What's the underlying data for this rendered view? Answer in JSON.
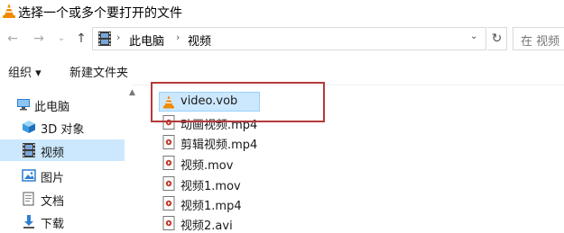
{
  "window": {
    "title": "选择一个或多个要打开的文件"
  },
  "navigation": {
    "back_icon": "←",
    "forward_icon": "→",
    "dropdown_icon": "⌄",
    "up_icon": "↑"
  },
  "address_bar": {
    "breadcrumbs": [
      "此电脑",
      "视频"
    ],
    "separator": "›",
    "dropdown_icon": "⌄",
    "refresh_icon": "↻"
  },
  "search": {
    "placeholder": "在 视频"
  },
  "toolbar": {
    "organize_label": "组织 ▾",
    "new_folder_label": "新建文件夹"
  },
  "sidebar": {
    "items": [
      {
        "label": "此电脑",
        "icon": "computer-icon",
        "selected": false
      },
      {
        "label": "3D 对象",
        "icon": "cube-icon",
        "selected": false
      },
      {
        "label": "视频",
        "icon": "film-icon",
        "selected": true
      },
      {
        "label": "图片",
        "icon": "picture-icon",
        "selected": false
      },
      {
        "label": "文档",
        "icon": "document-icon",
        "selected": false
      },
      {
        "label": "下载",
        "icon": "download-icon",
        "selected": false
      }
    ]
  },
  "files": [
    {
      "name": "video.vob",
      "icon": "vlc-cone-icon",
      "selected": true
    },
    {
      "name": "动画视频.mp4",
      "icon": "video-file-icon",
      "selected": false
    },
    {
      "name": "剪辑视频.mp4",
      "icon": "video-file-icon",
      "selected": false
    },
    {
      "name": "视频.mov",
      "icon": "video-file-icon",
      "selected": false
    },
    {
      "name": "视频1.mov",
      "icon": "video-file-icon",
      "selected": false
    },
    {
      "name": "视频1.mp4",
      "icon": "video-file-icon",
      "selected": false
    },
    {
      "name": "视频2.avi",
      "icon": "video-file-icon",
      "selected": false
    }
  ],
  "colors": {
    "selection": "#cce8ff",
    "selection_border": "#99d1ff",
    "annotation_box": "#b43a3a",
    "vlc_orange": "#f08a00"
  }
}
